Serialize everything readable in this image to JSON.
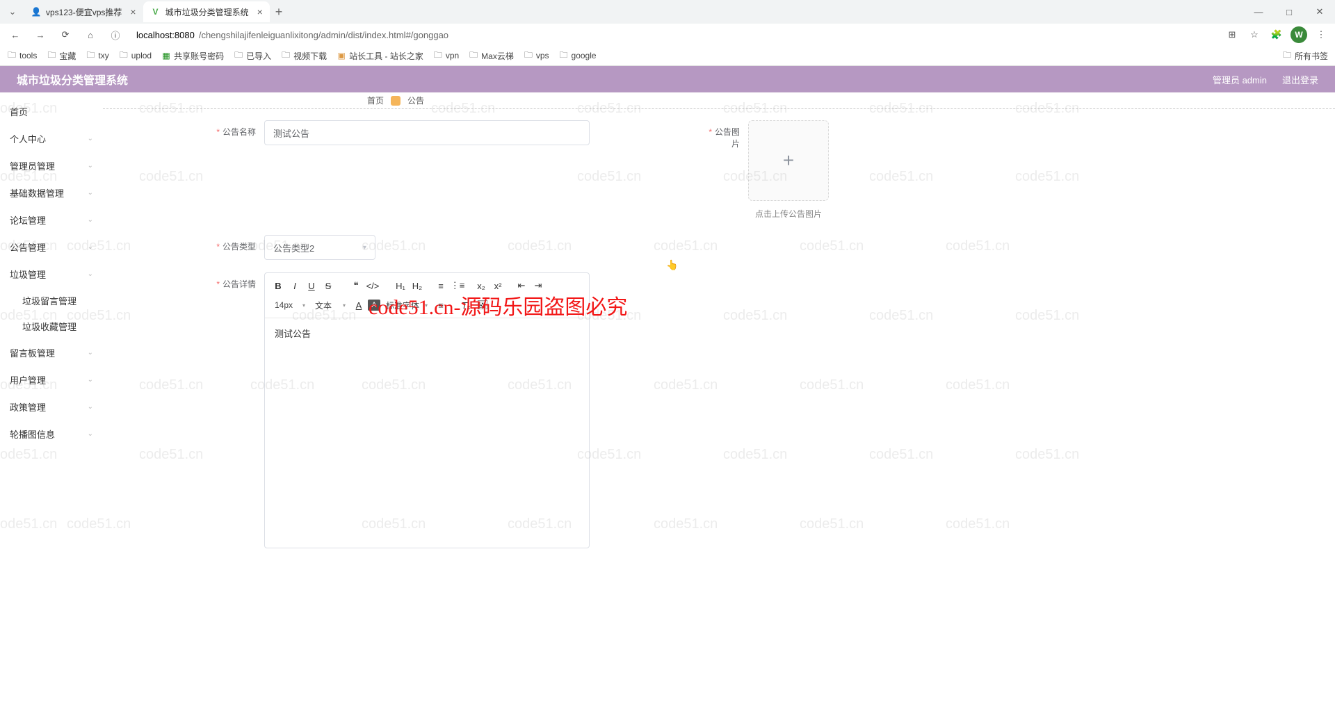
{
  "browser": {
    "tabs": [
      {
        "icon": "👤",
        "title": "vps123-便宜vps推荐"
      },
      {
        "icon": "V",
        "title": "城市垃圾分类管理系统"
      }
    ],
    "url_host": "localhost:8080",
    "url_path": "/chengshilajifenleiguanlixitong/admin/dist/index.html#/gonggao",
    "avatar_letter": "W",
    "win": {
      "min": "—",
      "max": "□",
      "close": "✕"
    }
  },
  "bookmarks": {
    "items": [
      "tools",
      "宝藏",
      "txy",
      "uplod",
      "共享账号密码",
      "已导入",
      "视频下载",
      "站长工具 - 站长之家",
      "vpn",
      "Max云梯",
      "vps",
      "google"
    ],
    "all": "所有书签"
  },
  "header": {
    "title": "城市垃圾分类管理系统",
    "user": "管理员 admin",
    "logout": "退出登录"
  },
  "sidebar": {
    "items": [
      "首页",
      "个人中心",
      "管理员管理",
      "基础数据管理",
      "论坛管理",
      "公告管理",
      "垃圾管理"
    ],
    "subs": [
      "垃圾留言管理",
      "垃圾收藏管理"
    ],
    "tail": [
      "留言板管理",
      "用户管理",
      "政策管理",
      "轮播图信息"
    ]
  },
  "breadcrumb": {
    "home": "首页",
    "current": "公告"
  },
  "form": {
    "name_label": "公告名称",
    "name_value": "测试公告",
    "img_label": "公告图片",
    "img_hint": "点击上传公告图片",
    "type_label": "公告类型",
    "type_value": "公告类型2",
    "detail_label": "公告详情",
    "editor_content": "测试公告"
  },
  "editor": {
    "font_size": "14px",
    "text_type": "文本",
    "font_family": "标准字体"
  },
  "watermark": {
    "text": "code51.cn",
    "big": "code51.cn-源码乐园盗图必究"
  }
}
